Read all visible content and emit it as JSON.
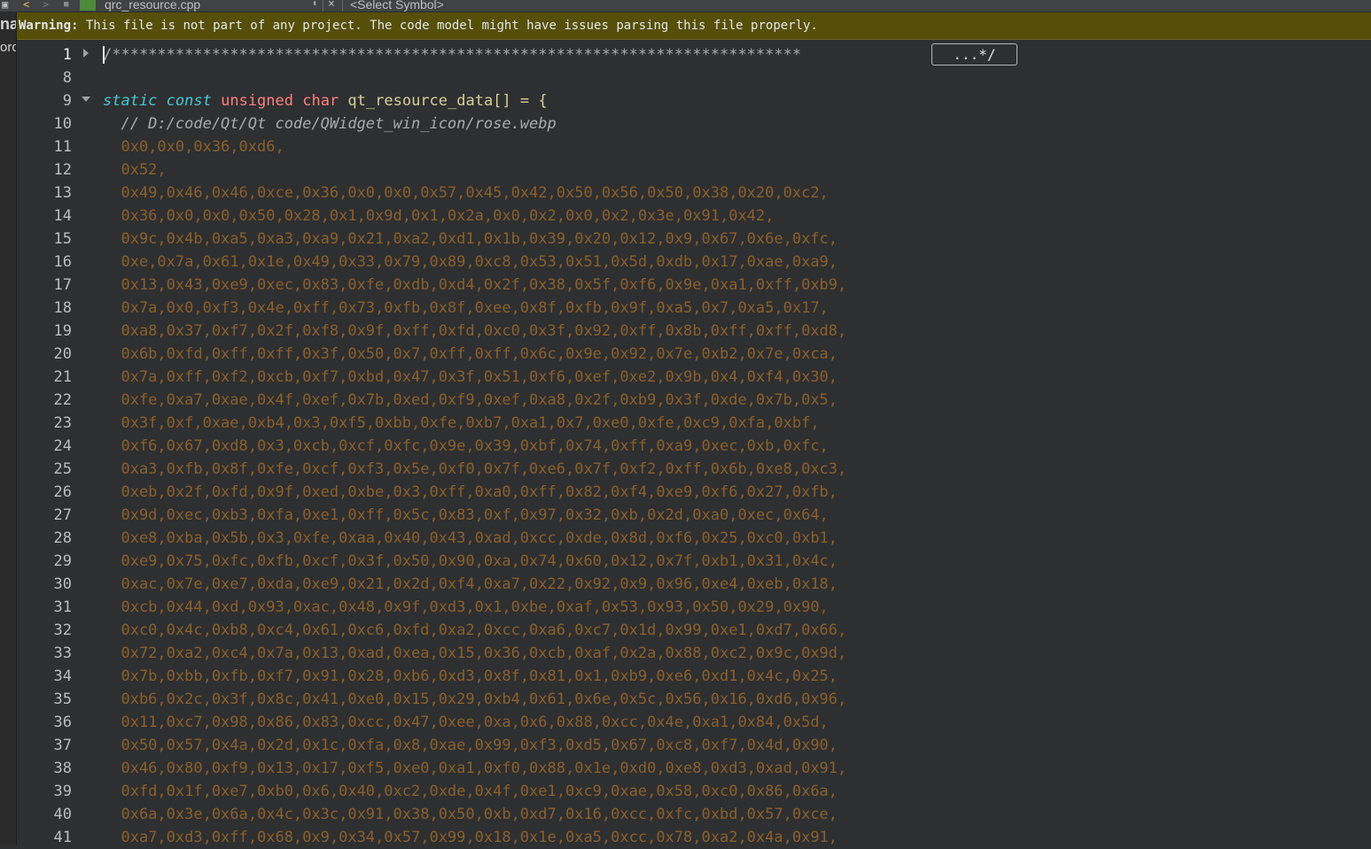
{
  "toolbar": {
    "back": "<",
    "forward": ">",
    "file_name": "qrc_resource.cpp",
    "close": "×",
    "symbol_selector": "<Select Symbol>"
  },
  "sidebar": {
    "label_top": "na",
    "label_bottom": "orc"
  },
  "warning": {
    "label": "Warning:",
    "message": "This file is not part of any project. The code model might have issues parsing this file properly."
  },
  "editor": {
    "collapsed_comment": "/****************************************************************************",
    "collapsed_marker": "...*/",
    "declaration": {
      "kw1": "static",
      "kw2": "const",
      "type": "unsigned char",
      "name": "qt_resource_data[]",
      "rest": " = {"
    },
    "path_comment": "// D:/code/Qt/Qt code/QWidget_win_icon/rose.webp",
    "lines": [
      {
        "n": "1",
        "text": ""
      },
      {
        "n": "8",
        "text": ""
      },
      {
        "n": "9",
        "text": ""
      },
      {
        "n": "10",
        "text": ""
      },
      {
        "n": "11",
        "text": "0x0,0x0,0x36,0xd6,"
      },
      {
        "n": "12",
        "text": "0x52,"
      },
      {
        "n": "13",
        "text": "0x49,0x46,0x46,0xce,0x36,0x0,0x0,0x57,0x45,0x42,0x50,0x56,0x50,0x38,0x20,0xc2,"
      },
      {
        "n": "14",
        "text": "0x36,0x0,0x0,0x50,0x28,0x1,0x9d,0x1,0x2a,0x0,0x2,0x0,0x2,0x3e,0x91,0x42,"
      },
      {
        "n": "15",
        "text": "0x9c,0x4b,0xa5,0xa3,0xa9,0x21,0xa2,0xd1,0x1b,0x39,0x20,0x12,0x9,0x67,0x6e,0xfc,"
      },
      {
        "n": "16",
        "text": "0xe,0x7a,0x61,0x1e,0x49,0x33,0x79,0x89,0xc8,0x53,0x51,0x5d,0xdb,0x17,0xae,0xa9,"
      },
      {
        "n": "17",
        "text": "0x13,0x43,0xe9,0xec,0x83,0xfe,0xdb,0xd4,0x2f,0x38,0x5f,0xf6,0x9e,0xa1,0xff,0xb9,"
      },
      {
        "n": "18",
        "text": "0x7a,0x0,0xf3,0x4e,0xff,0x73,0xfb,0x8f,0xee,0x8f,0xfb,0x9f,0xa5,0x7,0xa5,0x17,"
      },
      {
        "n": "19",
        "text": "0xa8,0x37,0xf7,0x2f,0xf8,0x9f,0xff,0xfd,0xc0,0x3f,0x92,0xff,0x8b,0xff,0xff,0xd8,"
      },
      {
        "n": "20",
        "text": "0x6b,0xfd,0xff,0xff,0x3f,0x50,0x7,0xff,0xff,0x6c,0x9e,0x92,0x7e,0xb2,0x7e,0xca,"
      },
      {
        "n": "21",
        "text": "0x7a,0xff,0xf2,0xcb,0xf7,0xbd,0x47,0x3f,0x51,0xf6,0xef,0xe2,0x9b,0x4,0xf4,0x30,"
      },
      {
        "n": "22",
        "text": "0xfe,0xa7,0xae,0x4f,0xef,0x7b,0xed,0xf9,0xef,0xa8,0x2f,0xb9,0x3f,0xde,0x7b,0x5,"
      },
      {
        "n": "23",
        "text": "0x3f,0xf,0xae,0xb4,0x3,0xf5,0xbb,0xfe,0xb7,0xa1,0x7,0xe0,0xfe,0xc9,0xfa,0xbf,"
      },
      {
        "n": "24",
        "text": "0xf6,0x67,0xd8,0x3,0xcb,0xcf,0xfc,0x9e,0x39,0xbf,0x74,0xff,0xa9,0xec,0xb,0xfc,"
      },
      {
        "n": "25",
        "text": "0xa3,0xfb,0x8f,0xfe,0xcf,0xf3,0x5e,0xf0,0x7f,0xe6,0x7f,0xf2,0xff,0x6b,0xe8,0xc3,"
      },
      {
        "n": "26",
        "text": "0xeb,0x2f,0xfd,0x9f,0xed,0xbe,0x3,0xff,0xa0,0xff,0x82,0xf4,0xe9,0xf6,0x27,0xfb,"
      },
      {
        "n": "27",
        "text": "0x9d,0xec,0xb3,0xfa,0xe1,0xff,0x5c,0x83,0xf,0x97,0x32,0xb,0x2d,0xa0,0xec,0x64,"
      },
      {
        "n": "28",
        "text": "0xe8,0xba,0x5b,0x3,0xfe,0xaa,0x40,0x43,0xad,0xcc,0xde,0x8d,0xf6,0x25,0xc0,0xb1,"
      },
      {
        "n": "29",
        "text": "0xe9,0x75,0xfc,0xfb,0xcf,0x3f,0x50,0x90,0xa,0x74,0x60,0x12,0x7f,0xb1,0x31,0x4c,"
      },
      {
        "n": "30",
        "text": "0xac,0x7e,0xe7,0xda,0xe9,0x21,0x2d,0xf4,0xa7,0x22,0x92,0x9,0x96,0xe4,0xeb,0x18,"
      },
      {
        "n": "31",
        "text": "0xcb,0x44,0xd,0x93,0xac,0x48,0x9f,0xd3,0x1,0xbe,0xaf,0x53,0x93,0x50,0x29,0x90,"
      },
      {
        "n": "32",
        "text": "0xc0,0x4c,0xb8,0xc4,0x61,0xc6,0xfd,0xa2,0xcc,0xa6,0xc7,0x1d,0x99,0xe1,0xd7,0x66,"
      },
      {
        "n": "33",
        "text": "0x72,0xa2,0xc4,0x7a,0x13,0xad,0xea,0x15,0x36,0xcb,0xaf,0x2a,0x88,0xc2,0x9c,0x9d,"
      },
      {
        "n": "34",
        "text": "0x7b,0xbb,0xfb,0xf7,0x91,0x28,0xb6,0xd3,0x8f,0x81,0x1,0xb9,0xe6,0xd1,0x4c,0x25,"
      },
      {
        "n": "35",
        "text": "0xb6,0x2c,0x3f,0x8c,0x41,0xe0,0x15,0x29,0xb4,0x61,0x6e,0x5c,0x56,0x16,0xd6,0x96,"
      },
      {
        "n": "36",
        "text": "0x11,0xc7,0x98,0x86,0x83,0xcc,0x47,0xee,0xa,0x6,0x88,0xcc,0x4e,0xa1,0x84,0x5d,"
      },
      {
        "n": "37",
        "text": "0x50,0x57,0x4a,0x2d,0x1c,0xfa,0x8,0xae,0x99,0xf3,0xd5,0x67,0xc8,0xf7,0x4d,0x90,"
      },
      {
        "n": "38",
        "text": "0x46,0x80,0xf9,0x13,0x17,0xf5,0xe0,0xa1,0xf0,0x88,0x1e,0xd0,0xe8,0xd3,0xad,0x91,"
      },
      {
        "n": "39",
        "text": "0xfd,0x1f,0xe7,0xb0,0x6,0x40,0xc2,0xde,0x4f,0xe1,0xc9,0xae,0x58,0xc0,0x86,0x6a,"
      },
      {
        "n": "40",
        "text": "0x6a,0x3e,0x6a,0x4c,0x3c,0x91,0x38,0x50,0xb,0xd7,0x16,0xcc,0xfc,0xbd,0x57,0xce,"
      },
      {
        "n": "41",
        "text": "0xa7,0xd3,0xff,0x68,0x9,0x34,0x57,0x99,0x18,0x1e,0xa5,0xcc,0x78,0xa2,0x4a,0x91,"
      }
    ]
  }
}
